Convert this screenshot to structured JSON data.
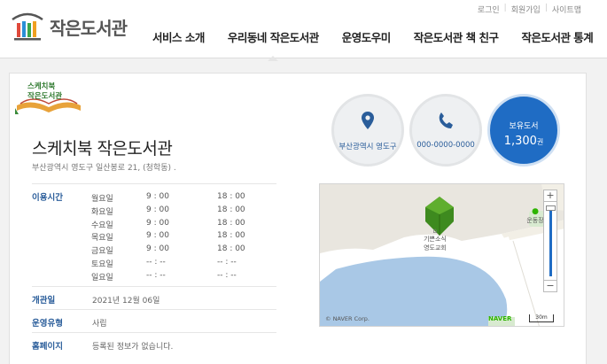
{
  "header": {
    "logo_text": "작은도서관",
    "util_links": [
      "로그인",
      "회원가입",
      "사이트맵"
    ],
    "nav": [
      {
        "label": "서비스 소개",
        "active": false
      },
      {
        "label": "우리동네 작은도서관",
        "active": true
      },
      {
        "label": "운영도우미",
        "active": false
      },
      {
        "label": "작은도서관 책 친구",
        "active": false
      },
      {
        "label": "작은도서관 통계",
        "active": false
      }
    ]
  },
  "library": {
    "badge_line1": "스케치북",
    "badge_line2": "작은도서관",
    "name": "스케치북 작은도서관",
    "address": "부산광역시 영도구 일산봉로 21, (청학동) ."
  },
  "info": {
    "hours_label": "이용시간",
    "hours": [
      {
        "day": "월요일",
        "open": "9 : 00",
        "close": "18 : 00"
      },
      {
        "day": "화요일",
        "open": "9 : 00",
        "close": "18 : 00"
      },
      {
        "day": "수요일",
        "open": "9 : 00",
        "close": "18 : 00"
      },
      {
        "day": "목요일",
        "open": "9 : 00",
        "close": "18 : 00"
      },
      {
        "day": "금요일",
        "open": "9 : 00",
        "close": "18 : 00"
      },
      {
        "day": "토요일",
        "open": "-- : --",
        "close": "-- : --"
      },
      {
        "day": "일요일",
        "open": "-- : --",
        "close": "-- : --"
      }
    ],
    "opened_label": "개관일",
    "opened_value": "2021년 12월 06일",
    "type_label": "운영유형",
    "type_value": "사립",
    "homepage_label": "홈페이지",
    "homepage_value": "등록된 정보가 없습니다."
  },
  "circles": {
    "region": "부산광역시 영도구",
    "phone": "000-0000-0000",
    "books_label": "보유도서",
    "books_count": "1,300",
    "books_unit": "권"
  },
  "map": {
    "place_line1": "기쁜소식",
    "place_line2": "영도교회",
    "poi_label": "운동장",
    "copyright": "© NAVER Corp.",
    "brand": "NAVER",
    "scale": "30m",
    "zoom_in": "+",
    "zoom_out": "−"
  },
  "colors": {
    "accent": "#2a5d9a",
    "books_circle": "#1f6cc4",
    "marker": "#3e8a1f"
  }
}
